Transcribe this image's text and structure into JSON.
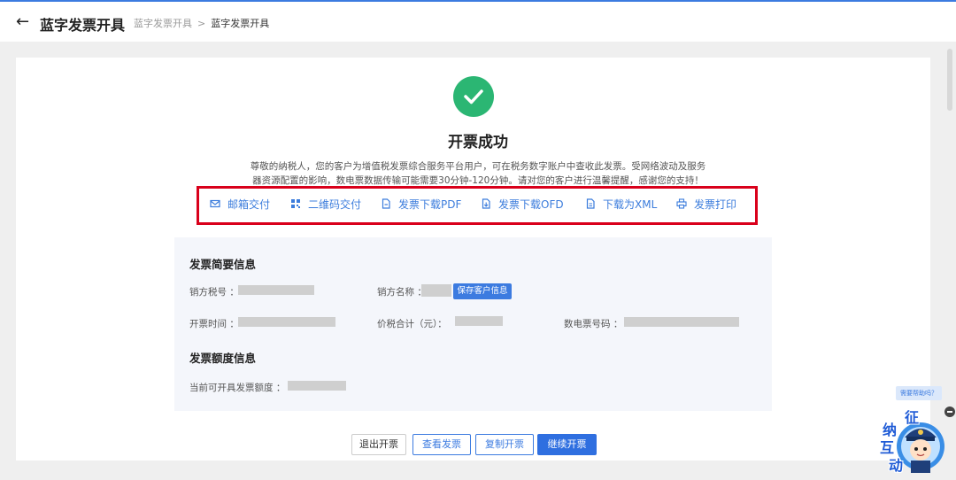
{
  "header": {
    "title": "蓝字发票开具",
    "breadcrumb": [
      "蓝字发票开具",
      "蓝字发票开具"
    ]
  },
  "result": {
    "title": "开票成功",
    "notice_line1": "尊敬的纳税人，您的客户为增值税发票综合服务平台用户，可在税务数字账户中查收此发票。受网络波动及服务",
    "notice_line2": "器资源配置的影响，数电票数据传输可能需要30分钟-120分钟。请对您的客户进行温馨提醒，感谢您的支持！"
  },
  "actions": [
    {
      "label": "邮箱交付",
      "icon": "mail-icon"
    },
    {
      "label": "二维码交付",
      "icon": "qrcode-icon"
    },
    {
      "label": "发票下载PDF",
      "icon": "pdf-icon"
    },
    {
      "label": "发票下载OFD",
      "icon": "ofd-icon"
    },
    {
      "label": "下载为XML",
      "icon": "xml-icon"
    },
    {
      "label": "发票打印",
      "icon": "printer-icon"
    }
  ],
  "summary": {
    "title": "发票简要信息",
    "seller_tax_no_label": "销方税号 ：",
    "seller_name_label": "销方名称 ：",
    "save_customer_label": "保存客户信息",
    "issue_time_label": "开票时间 ：",
    "total_label": "价税合计（元）：",
    "invoice_no_label": "数电票号码 ："
  },
  "quota": {
    "title": "发票额度信息",
    "available_label": "当前可开具发票额度 ："
  },
  "buttons": {
    "exit": "退出开票",
    "view": "查看发票",
    "copy": "复制开票",
    "continue": "继续开票"
  },
  "assistant": {
    "help": "需要帮助吗？",
    "chars": [
      "征",
      "纳",
      "互",
      "动"
    ]
  },
  "colors": {
    "primary": "#3c7be0",
    "success": "#2bb673",
    "highlight": "#d9001b"
  }
}
